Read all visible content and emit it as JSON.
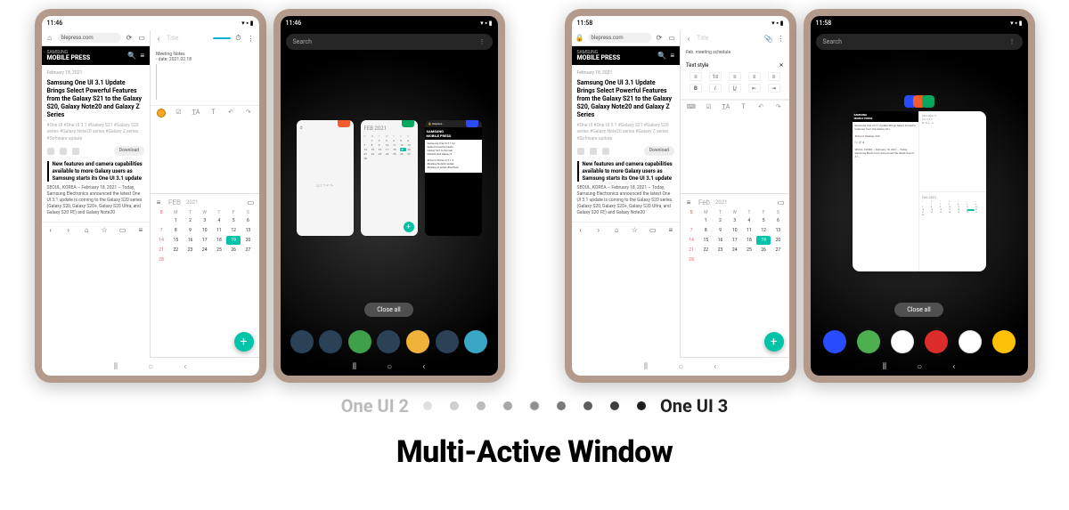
{
  "labels": {
    "left": "One UI 2",
    "right": "One UI 3",
    "title": "Multi-Active Window"
  },
  "status": {
    "time1": "11:46",
    "time2": "11:58",
    "icons": "▾ ▪ ▮"
  },
  "browser": {
    "url": "blepress.com",
    "brand_small": "SAMSUNG",
    "brand": "MOBILE PRESS",
    "article_date": "February 18, 2021",
    "article_title": "Samsung One UI 3.1 Update Brings Select Powerful Features from the Galaxy S21 to the Galaxy S20, Galaxy Note20 and Galaxy Z Series",
    "tags": "#One UI  #One UI 3.1  #Galaxy S21  #Galaxy S20 series #Galaxy Note20 series  #Galaxy Z series  #Software update",
    "download": "Download",
    "subhead": "New features and camera capabilities available to more Galaxy users as Samsung starts its One UI 3.1 update",
    "body": "SEOUL, KOREA – February 18, 2021 – Today, Samsung Electronics announced the latest One UI 3.1 update is coming to the Galaxy S20 series (Galaxy S20, Galaxy S20+, Galaxy S20 Ultra, and Galaxy S20 FE) and Galaxy Note20"
  },
  "notes": {
    "title_ph": "Title",
    "meeting": "Meeting Notes",
    "date": "- date: 2021.02.18",
    "kb": "Feb. meeting schedule",
    "text_style": "Text style"
  },
  "calendar": {
    "month": "FEB",
    "month_l": "Feb",
    "year": "2021",
    "days": [
      "S",
      "M",
      "T",
      "W",
      "T",
      "F",
      "S"
    ],
    "weeks": [
      [
        "",
        "1",
        "2",
        "3",
        "4",
        "5",
        "6"
      ],
      [
        "7",
        "8",
        "9",
        "10",
        "11",
        "12",
        "13"
      ],
      [
        "14",
        "15",
        "16",
        "17",
        "18",
        "19",
        "20"
      ],
      [
        "21",
        "22",
        "23",
        "24",
        "25",
        "26",
        "27"
      ],
      [
        "28",
        "",
        "",
        "",
        "",
        "",
        ""
      ]
    ],
    "today": "19"
  },
  "recents": {
    "search": "Search",
    "close_all": "Close all"
  },
  "gradient_dots": [
    "#e0e0e0",
    "#cfcfcf",
    "#bcbcbc",
    "#a8a8a8",
    "#929292",
    "#7a7a7a",
    "#5e5e5e",
    "#3f3f3f",
    "#1e1e1e"
  ],
  "dock_colors_ui2": [
    "#2b4256",
    "#2b4256",
    "#3da04a",
    "#2b4256",
    "#f0b23a",
    "#2b4256",
    "#39a6c5"
  ],
  "dock_colors_ui3": [
    "#2a4cff",
    "#4caf50",
    "#ffffff",
    "#dd2c2c",
    "#ffffff",
    "#ffc107"
  ]
}
